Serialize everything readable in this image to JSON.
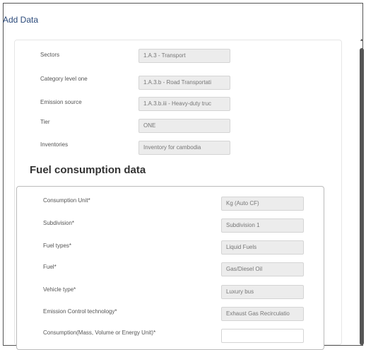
{
  "page": {
    "title": "Add Data"
  },
  "general": [
    {
      "label": "Sectors",
      "value": "1.A.3 - Transport"
    },
    {
      "label": "Category level one",
      "value": "1.A.3.b - Road Transportati"
    },
    {
      "label": "Emission source",
      "value": "1.A.3.b.iii - Heavy-duty truc"
    },
    {
      "label": "Tier",
      "value": "ONE"
    },
    {
      "label": "Inventories",
      "value": "Inventory for cambodia"
    }
  ],
  "fuel_section": {
    "title": "Fuel consumption data",
    "rows": [
      {
        "label": "Consumption Unit*",
        "value": "Kg (Auto CF)"
      },
      {
        "label": "Subdivision*",
        "value": "Subdivision 1"
      },
      {
        "label": "Fuel types*",
        "value": "Liquid Fuels"
      },
      {
        "label": "Fuel*",
        "value": "Gas/Diesel Oil"
      },
      {
        "label": "Vehicle type*",
        "value": "Luxury bus"
      },
      {
        "label": "Emission Control technology*",
        "value": "Exhaust Gas Recirculatio"
      },
      {
        "label": "Consumption(Mass, Volume or Energy Unit)*",
        "value": ""
      }
    ]
  }
}
